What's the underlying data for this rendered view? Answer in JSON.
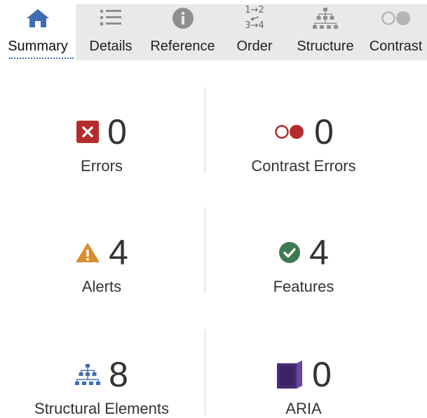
{
  "tabs": [
    {
      "label": "Summary",
      "icon": "home-icon",
      "active": true
    },
    {
      "label": "Details",
      "icon": "list-icon",
      "active": false
    },
    {
      "label": "Reference",
      "icon": "info-icon",
      "active": false
    },
    {
      "label": "Order",
      "icon": "order-icon",
      "active": false,
      "icon_text": {
        "top": "1→2",
        "bottom": "3→4"
      }
    },
    {
      "label": "Structure",
      "icon": "structure-icon",
      "active": false
    },
    {
      "label": "Contrast",
      "icon": "contrast-icon",
      "active": false
    }
  ],
  "summary": {
    "errors": {
      "count": "0",
      "label": "Errors",
      "icon": "error-icon"
    },
    "contrast_errors": {
      "count": "0",
      "label": "Contrast Errors",
      "icon": "contrast-error-icon"
    },
    "alerts": {
      "count": "4",
      "label": "Alerts",
      "icon": "alert-icon"
    },
    "features": {
      "count": "4",
      "label": "Features",
      "icon": "feature-icon"
    },
    "structural_elements": {
      "count": "8",
      "label": "Structural Elements",
      "icon": "structure-icon"
    },
    "aria": {
      "count": "0",
      "label": "ARIA",
      "icon": "aria-icon"
    }
  },
  "colors": {
    "accent": "#3f6eb5",
    "error": "#b52b2b",
    "contrast_error": "#b52b2b",
    "alert": "#d98e2c",
    "feature": "#3d7a4f",
    "structure": "#3f6eb5",
    "aria": "#4a2a78",
    "tab_icon_gray": "#8f8f8f",
    "tab_bg": "#e9e9ea"
  }
}
